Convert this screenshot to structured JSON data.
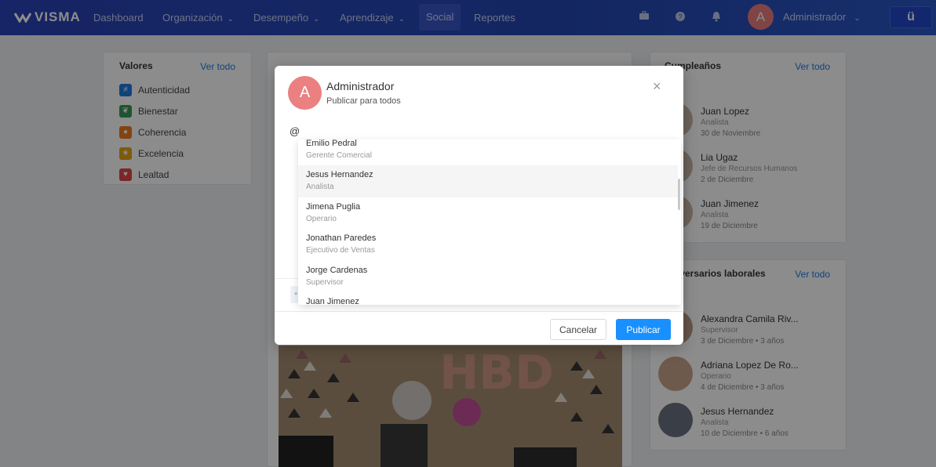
{
  "nav": {
    "brand": "VISMA",
    "items": [
      {
        "label": "Dashboard",
        "chev": ""
      },
      {
        "label": "Organización",
        "chev": "⌄"
      },
      {
        "label": "Desempeño",
        "chev": "⌄"
      },
      {
        "label": "Aprendizaje",
        "chev": "⌄"
      },
      {
        "label": "Social",
        "chev": ""
      },
      {
        "label": "Reportes",
        "chev": ""
      }
    ],
    "avatar_letter": "A",
    "user": "Administrador",
    "u_button": "ü"
  },
  "valores": {
    "title": "Valores",
    "ver_todo": "Ver todo",
    "items": [
      {
        "label": "Autenticidad",
        "icon": "≠",
        "color": "#1f7ae0"
      },
      {
        "label": "Bienestar",
        "icon": "❦",
        "color": "#3a9a54"
      },
      {
        "label": "Coherencia",
        "icon": "●",
        "color": "#ef7d1d"
      },
      {
        "label": "Excelencia",
        "icon": "★",
        "color": "#e8a316"
      },
      {
        "label": "Lealtad",
        "icon": "♥",
        "color": "#e0454a"
      }
    ]
  },
  "cumpleanos": {
    "title": "Cumpleaños",
    "ver_todo": "Ver todo",
    "people": [
      {
        "name": "Juan Lopez",
        "role": "Analista",
        "date": "30 de Noviembre"
      },
      {
        "name": "Lia Ugaz",
        "role": "Jefe de Recursos Humanos",
        "date": "2 de Diciembre"
      },
      {
        "name": "Juan Jimenez",
        "role": "Analista",
        "date": "19 de Diciembre"
      }
    ]
  },
  "aniversarios": {
    "title": "Aniversarios laborales",
    "ver_todo": "Ver todo",
    "people": [
      {
        "name": "Alexandra Camila Riv...",
        "role": "Supervisor",
        "date": "3 de Diciembre • 3 años"
      },
      {
        "name": "Adriana Lopez De Ro...",
        "role": "Operario",
        "date": "4 de Diciembre • 3 años"
      },
      {
        "name": "Jesus Hernandez",
        "role": "Analista",
        "date": "10 de Diciembre • 6 años"
      }
    ]
  },
  "modal": {
    "avatar_letter": "A",
    "author": "Administrador",
    "audience": "Publicar para todos",
    "close": "×",
    "input_value": "@",
    "cancel": "Cancelar",
    "publish": "Publicar"
  },
  "mentions": [
    {
      "name": "Emilio Pedral",
      "role": "Gerente Comercial"
    },
    {
      "name": "Jesus Hernandez",
      "role": "Analista"
    },
    {
      "name": "Jimena Puglia",
      "role": "Operario"
    },
    {
      "name": "Jonathan Paredes",
      "role": "Ejecutivo de Ventas"
    },
    {
      "name": "Jorge Cardenas",
      "role": "Supervisor"
    },
    {
      "name": "Juan Jimenez",
      "role": ""
    }
  ]
}
